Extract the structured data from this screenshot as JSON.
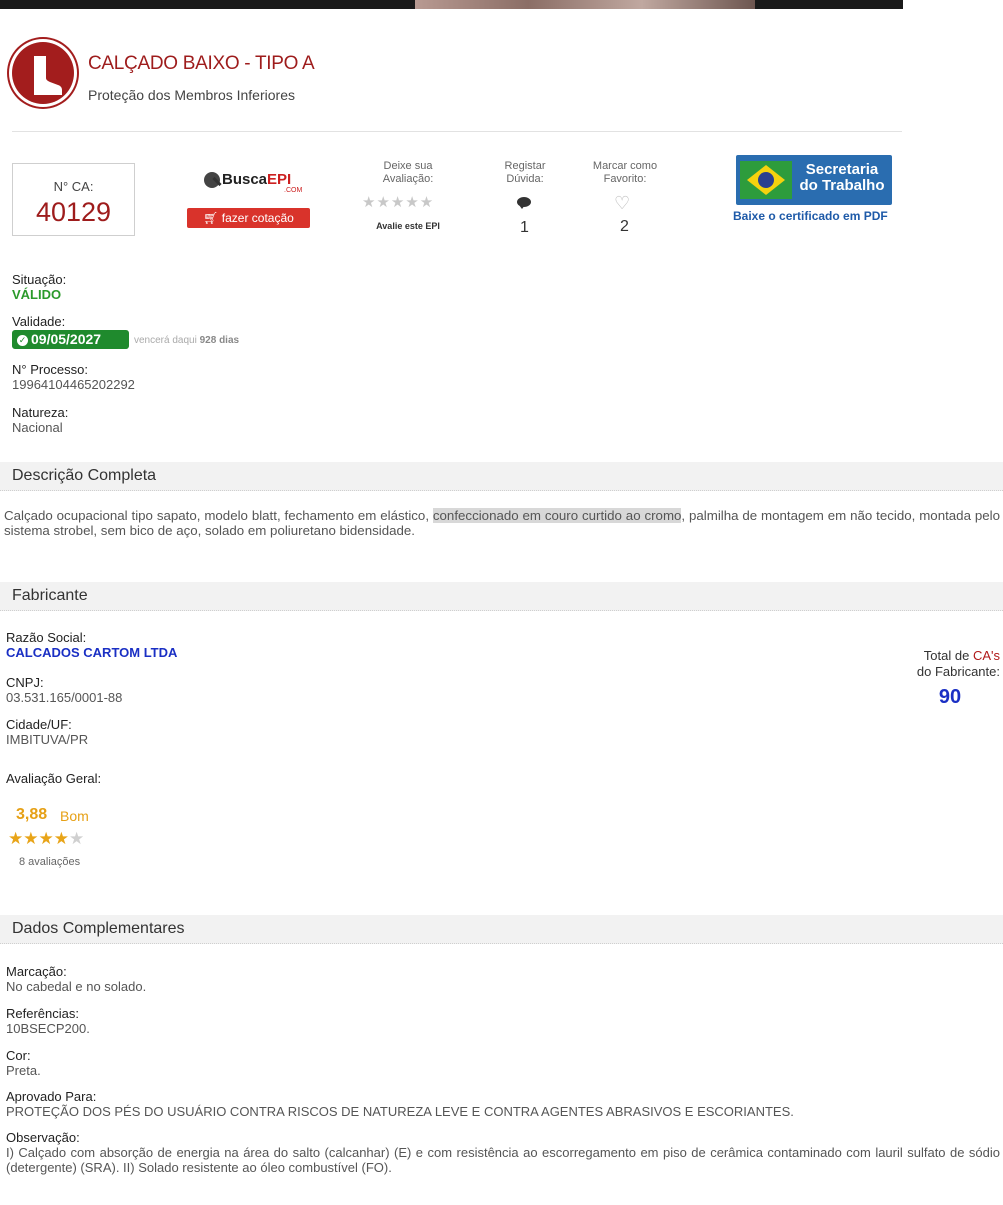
{
  "header": {
    "title": "CALÇADO BAIXO - TIPO A",
    "subtitle": "Proteção dos Membros Inferiores",
    "icon": "boot-icon",
    "accent_color": "#9e1c1c"
  },
  "ca": {
    "label": "N° CA:",
    "number": "40129"
  },
  "busca": {
    "logo_main": "Busca",
    "logo_accent": "EPI",
    "logo_sub": ".COM",
    "quote_button": "fazer cotação"
  },
  "rating_widget": {
    "label_line1": "Deixe sua",
    "label_line2": "Avaliação:",
    "stars": "★★★★★",
    "cta": "Avalie este EPI"
  },
  "doubt": {
    "label_line1": "Registar",
    "label_line2": "Dúvida:",
    "count": "1"
  },
  "favorite": {
    "label_line1": "Marcar como",
    "label_line2": "Favorito:",
    "count": "2"
  },
  "secretaria": {
    "line1": "Secretaria",
    "line2": "do Trabalho",
    "link": "Baixe o certificado em PDF"
  },
  "status": {
    "situacao_label": "Situação:",
    "situacao_value": "VÁLIDO",
    "validade_label": "Validade:",
    "validade_date": "09/05/2027",
    "vence_prefix": "vencerá daqui",
    "vence_days": "928 dias",
    "processo_label": "N° Processo:",
    "processo_value": "19964104465202292",
    "natureza_label": "Natureza:",
    "natureza_value": "Nacional"
  },
  "descricao": {
    "heading": "Descrição Completa",
    "text_before": "Calçado ocupacional tipo sapato, modelo blatt, fechamento em elástico, ",
    "text_highlight": "confeccionado em couro curtido ao cromo",
    "text_after": ", palmilha de montagem em não tecido, montada pelo sistema strobel, sem bico de aço, solado em poliuretano bidensidade."
  },
  "fabricante": {
    "heading": "Fabricante",
    "razao_label": "Razão Social:",
    "razao_value": "CALCADOS CARTOM LTDA",
    "cnpj_label": "CNPJ:",
    "cnpj_value": "03.531.165/0001-88",
    "cidade_label": "Cidade/UF:",
    "cidade_value": "IMBITUVA/PR",
    "avaliacao_label": "Avaliação Geral:",
    "rating_value": "3,88",
    "rating_word": "Bom",
    "rating_stars_on": "★★★★",
    "rating_stars_off": "★",
    "rating_count": "8 avaliações",
    "total_prefix": "Total de ",
    "total_red": "CA's",
    "total_suffix": "do Fabricante:",
    "total_value": "90"
  },
  "complementares": {
    "heading": "Dados Complementares",
    "marcacao_label": "Marcação:",
    "marcacao_value": "No cabedal e no solado.",
    "referencias_label": "Referências:",
    "referencias_value": "10BSECP200.",
    "cor_label": "Cor:",
    "cor_value": "Preta.",
    "aprovado_label": "Aprovado Para:",
    "aprovado_value": "PROTEÇÃO DOS PÉS DO USUÁRIO CONTRA RISCOS DE NATUREZA LEVE E CONTRA AGENTES ABRASIVOS E ESCORIANTES.",
    "observacao_label": "Observação:",
    "observacao_value": "I) Calçado com absorção de energia na área do salto (calcanhar) (E) e com resistência ao escorregamento em piso de cerâmica contaminado com lauril sulfato de sódio (detergente) (SRA). II) Solado resistente ao óleo combustível (FO)."
  }
}
